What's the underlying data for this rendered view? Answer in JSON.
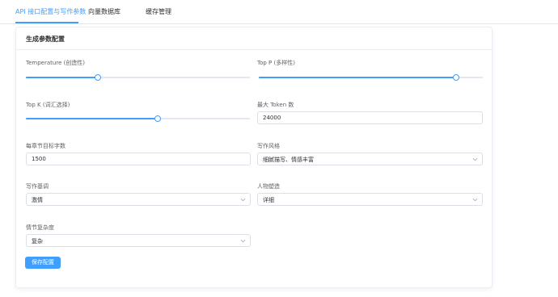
{
  "tabs": [
    {
      "label": "API 接口配置与写作参数"
    },
    {
      "label": "向量数据库"
    },
    {
      "label": "缓存管理"
    }
  ],
  "card": {
    "title": "生成参数配置"
  },
  "temperature": {
    "label": "Temperature (创造性)",
    "value_fraction": 0.32
  },
  "top_p": {
    "label": "Top P (多样性)",
    "value_fraction": 0.88
  },
  "top_k": {
    "label": "Top K (词汇选择)",
    "value_fraction": 0.59
  },
  "max_tokens": {
    "label": "最大 Token 数",
    "value": "24000"
  },
  "words_per_chapter": {
    "label": "每章节目标字数",
    "value": "1500"
  },
  "writing_style": {
    "label": "写作风格",
    "value": "细腻描写、情感丰富"
  },
  "writing_tone": {
    "label": "写作基调",
    "value": "激情"
  },
  "character_building": {
    "label": "人物塑造",
    "value": "详细"
  },
  "plot_complexity": {
    "label": "情节复杂度",
    "value": "复杂"
  },
  "save_button": {
    "label": "保存配置"
  },
  "colors": {
    "accent": "#409eff",
    "border": "#dcdfe6",
    "track": "#e4e7ed"
  },
  "icons": {
    "chevron": "chevron-down-icon"
  }
}
